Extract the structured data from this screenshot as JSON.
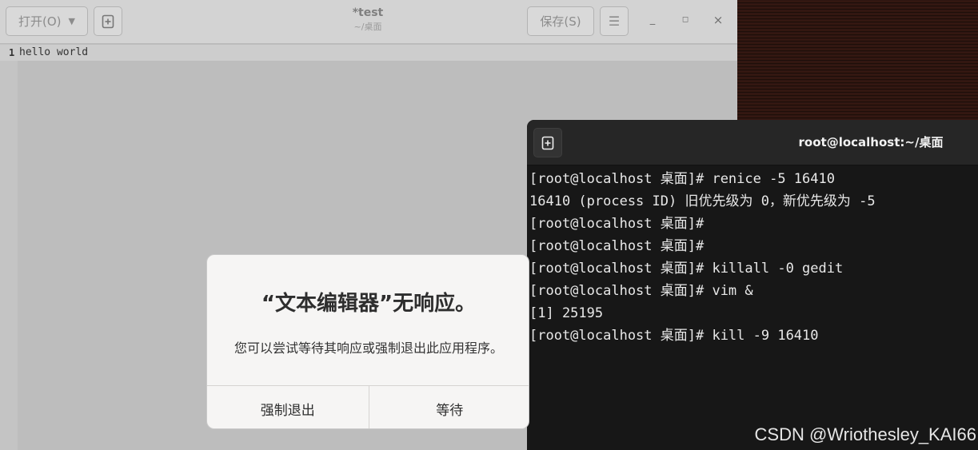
{
  "gedit": {
    "open_label": "打开(O)",
    "save_label": "保存(S)",
    "doc_title": "*test",
    "doc_path": "~/桌面",
    "lines": [
      {
        "num": "1",
        "text": "hello world"
      }
    ]
  },
  "terminal": {
    "title": "root@localhost:~/桌面",
    "lines": [
      "[root@localhost 桌面]# renice -5 16410",
      "16410 (process ID) 旧优先级为 0，新优先级为 -5",
      "[root@localhost 桌面]#",
      "[root@localhost 桌面]#",
      "[root@localhost 桌面]# killall -0 gedit",
      "[root@localhost 桌面]# vim &",
      "[1] 25195",
      "[root@localhost 桌面]# kill -9 16410"
    ]
  },
  "dialog": {
    "title": "“文本编辑器”无响应。",
    "message": "您可以尝试等待其响应或强制退出此应用程序。",
    "force_quit_label": "强制退出",
    "wait_label": "等待"
  },
  "watermark": "CSDN @Wriothesley_KAI66",
  "icons": {
    "open_dropdown": "chevron-down-icon",
    "new_document": "new-document-icon",
    "menu": "hamburger-menu-icon",
    "minimize": "minimize-icon",
    "maximize": "maximize-icon",
    "close": "close-icon",
    "new_tab": "new-tab-icon"
  }
}
